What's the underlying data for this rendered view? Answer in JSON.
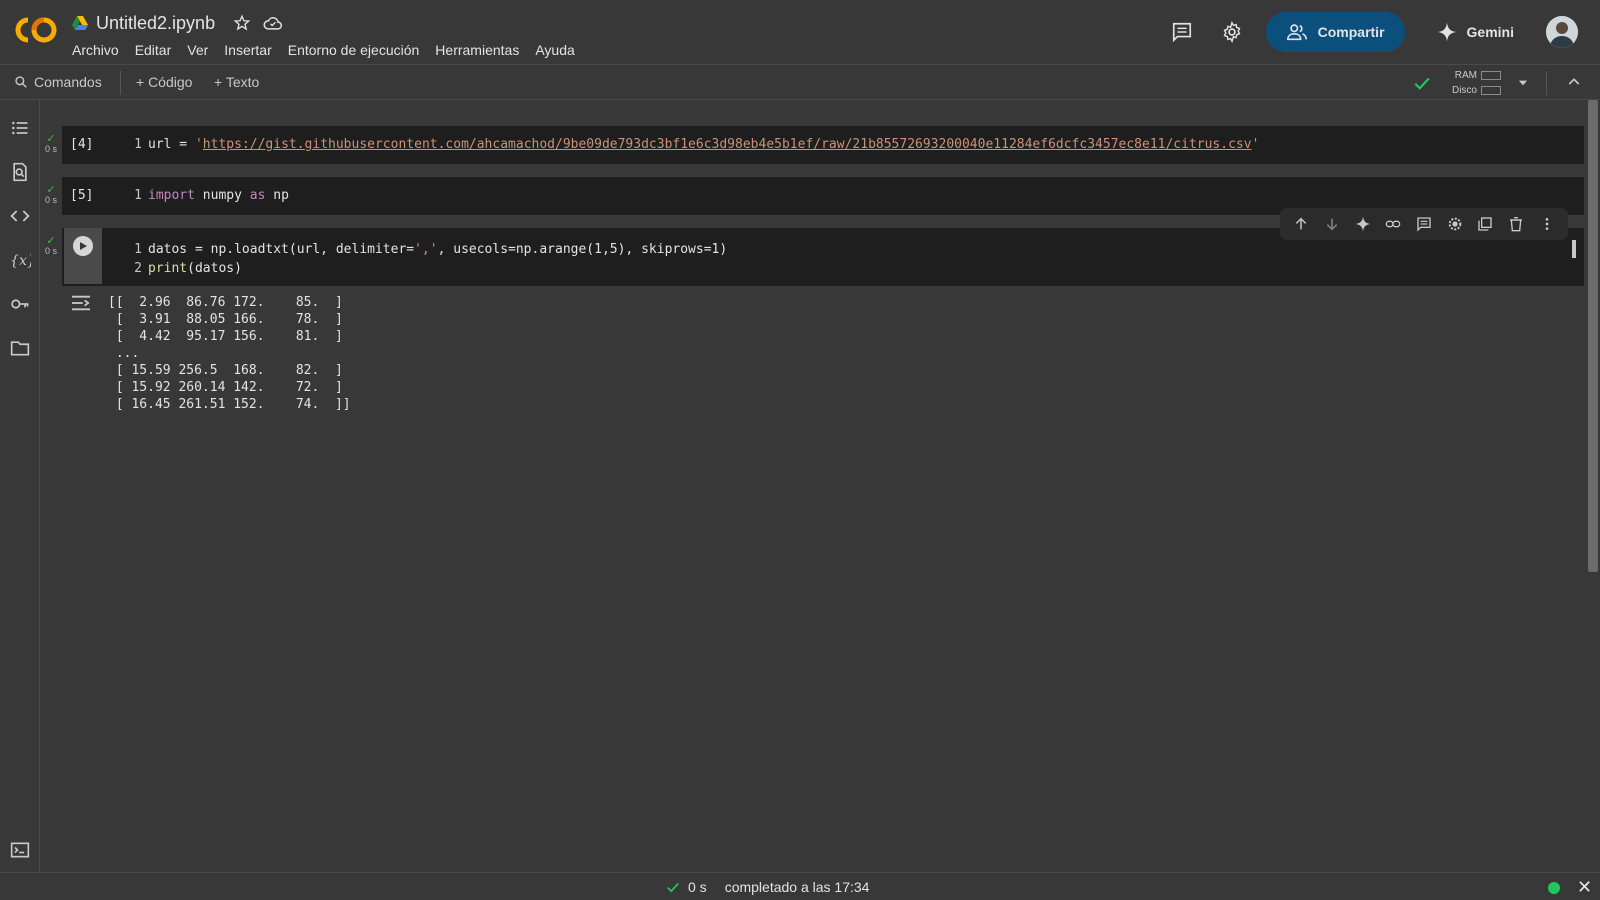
{
  "app": {
    "file_name": "Untitled2.ipynb",
    "menu": [
      "Archivo",
      "Editar",
      "Ver",
      "Insertar",
      "Entorno de ejecución",
      "Herramientas",
      "Ayuda"
    ],
    "share_label": "Compartir",
    "gemini_label": "Gemini"
  },
  "toolbar": {
    "commands_label": "Comandos",
    "add_code_label": "+ Código",
    "add_text_label": "+ Texto",
    "ram_label": "RAM",
    "disk_label": "Disco"
  },
  "cells": [
    {
      "exec_count": "[4]",
      "time": "0 s",
      "line_no": "1",
      "code_prefix": "url = ",
      "code_quote": "'",
      "code_url": "https://gist.githubusercontent.com/ahcamachod/9be09de793dc3bf1e6c3d98eb4e5b1ef/raw/21b85572693200040e11284ef6dcfc3457ec8e11/citrus.csv",
      "code_quote_end": "'"
    },
    {
      "exec_count": "[5]",
      "time": "0 s",
      "line_no": "1",
      "kw1": "import",
      "mid": " numpy ",
      "kw2": "as",
      "end": " np"
    },
    {
      "time": "0 s",
      "line1_no": "1",
      "line1_a": "datos = np.loadtxt(url, delimiter=",
      "line1_str": "','",
      "line1_b": ", usecols=np.arange(1,5), skiprows=1)",
      "line2_no": "2",
      "line2_fn": "print",
      "line2_b": "(datos)",
      "output": "[[  2.96  86.76 172.    85.  ]\n [  3.91  88.05 166.    78.  ]\n [  4.42  95.17 156.    81.  ]\n ...\n [ 15.59 256.5  168.    82.  ]\n [ 15.92 260.14 142.    72.  ]\n [ 16.45 261.51 152.    74.  ]]"
    }
  ],
  "status": {
    "elapsed": "0 s",
    "message": "completado a las 17:34"
  },
  "colors": {
    "accent": "#0b4f7d",
    "success": "#22c55e",
    "string": "#ce9178",
    "keyword": "#c586c0"
  }
}
